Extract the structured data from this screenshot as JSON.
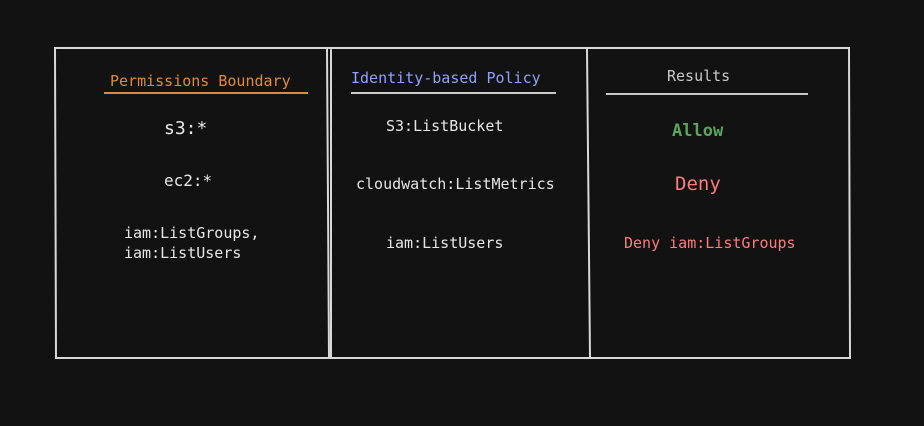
{
  "colors": {
    "background": "#121212",
    "border": "#d8d8d8",
    "boundary_heading": "#e08a3c",
    "identity_heading": "#8ea2f7",
    "results_heading": "#c9c9c9",
    "allow": "#5aa55a",
    "deny": "#ff7b7b",
    "text": "#e6e6e6"
  },
  "columns": {
    "boundary": {
      "heading": "Permissions Boundary",
      "items": [
        "s3:*",
        "ec2:*",
        "iam:ListGroups,",
        "iam:ListUsers"
      ]
    },
    "identity": {
      "heading": "Identity-based Policy",
      "items": [
        "S3:ListBucket",
        "cloudwatch:ListMetrics",
        "iam:ListUsers"
      ]
    },
    "results": {
      "heading": "Results",
      "items": [
        "Allow",
        "Deny",
        "Deny iam:ListGroups"
      ]
    }
  }
}
